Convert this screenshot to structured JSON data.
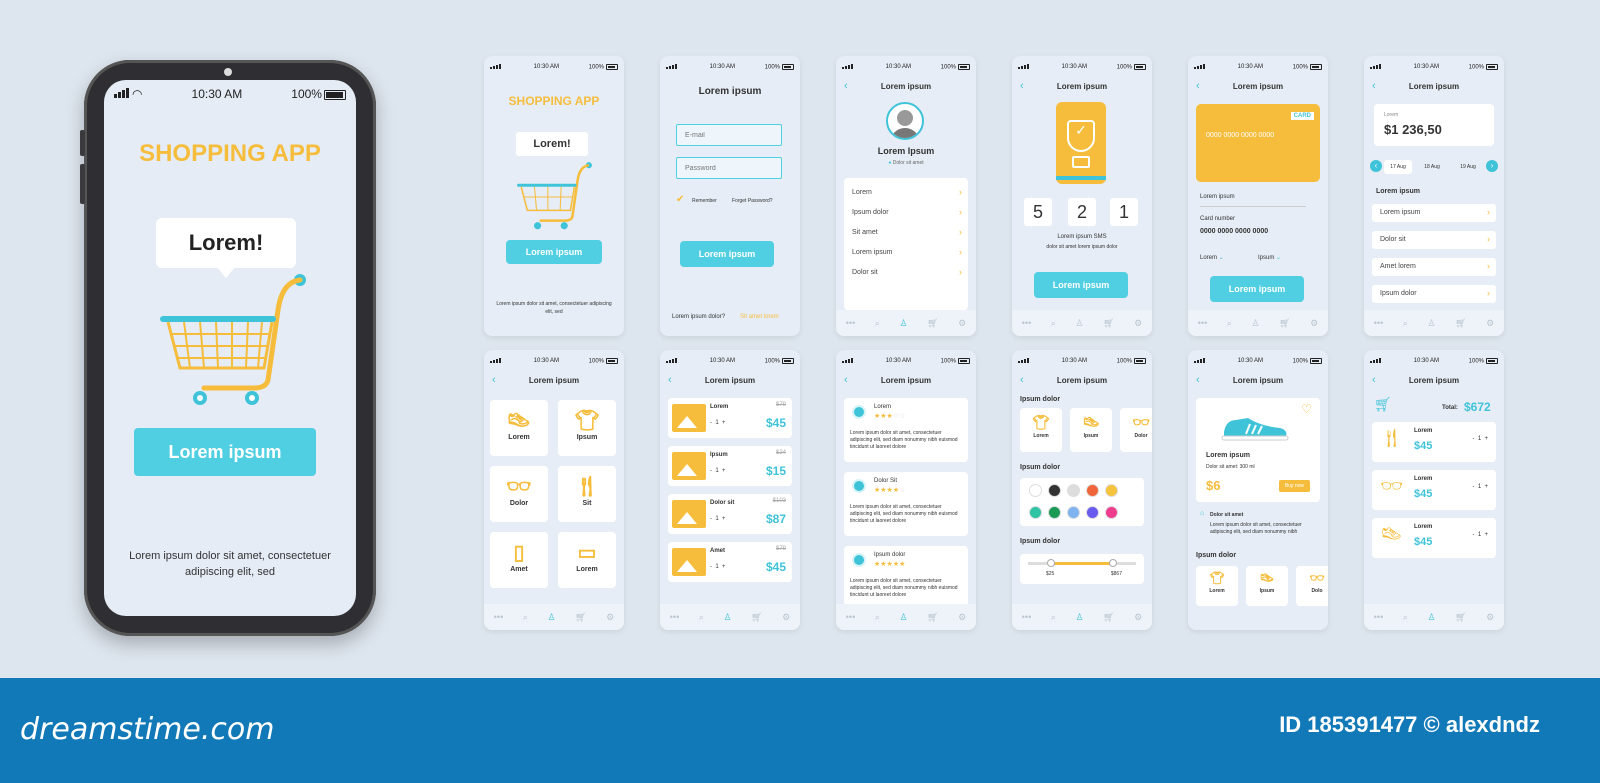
{
  "status": {
    "time": "10:30 AM",
    "battery": "100%"
  },
  "big": {
    "title": "SHOPPING APP",
    "bubble": "Lorem!",
    "button": "Lorem ipsum",
    "caption": "Lorem ipsum dolor sit amet, consectetuer adipiscing elit, sed"
  },
  "s1": {
    "title": "SHOPPING APP",
    "bubble": "Lorem!",
    "button": "Lorem ipsum",
    "caption": "Lorem ipsum dolor sit amet, consectetuer adipiscing elit, sed"
  },
  "s2": {
    "header": "Lorem ipsum",
    "email_placeholder": "E-mail",
    "password_placeholder": "Password",
    "remember": "Remember",
    "forgot": "Forget Password?",
    "button": "Lorem ipsum",
    "footer_q": "Lorem ipsum dolor?",
    "footer_link": "Sit amet lorem"
  },
  "s3": {
    "header": "Lorem ipsum",
    "name": "Lorem Ipsum",
    "location": "Dolor sit amet",
    "items": [
      "Lorem",
      "Ipsum dolor",
      "Sit amet",
      "Lorem ipsum",
      "Dolor sit"
    ]
  },
  "s4": {
    "header": "Lorem ipsum",
    "code": [
      "5",
      "2",
      "1"
    ],
    "sms": "Lorem ipsum SMS",
    "sms_sub": "dolor sit amet lorem ipsum dolor",
    "button": "Lorem ipsum"
  },
  "s5": {
    "header": "Lorem ipsum",
    "card_label": "CARD",
    "card_number": "0000 0000 0000 0000",
    "label1": "Lorem ipsum",
    "label2": "Card number",
    "number": "0000 0000 0000 0000",
    "dd1": "Lorem",
    "dd2": "Ipsum",
    "button": "Lorem ipsum"
  },
  "s6": {
    "header": "Lorem ipsum",
    "balance_label": "Lorem",
    "balance": "$1 236,50",
    "dates": [
      "17 Aug",
      "18 Aug",
      "19 Aug"
    ],
    "section": "Lorem ipsum",
    "items": [
      "Lorem ipsum",
      "Dolor sit",
      "Amet lorem",
      "Ipsum dolor"
    ]
  },
  "s7": {
    "header": "Lorem ipsum",
    "tiles": [
      "Lorem",
      "Ipsum",
      "Dolor",
      "Sit",
      "Amet",
      "Lorem"
    ]
  },
  "s8": {
    "header": "Lorem ipsum",
    "products": [
      {
        "name": "Lorem",
        "old": "$79",
        "price": "$45",
        "qty": "1"
      },
      {
        "name": "Ipsum",
        "old": "$24",
        "price": "$15",
        "qty": "1"
      },
      {
        "name": "Dolor sit",
        "old": "$103",
        "price": "$87",
        "qty": "1"
      },
      {
        "name": "Amet",
        "old": "$79",
        "price": "$45",
        "qty": "1"
      }
    ]
  },
  "s9": {
    "header": "Lorem ipsum",
    "reviews": [
      {
        "name": "Lorem",
        "stars": 3,
        "text": "Lorem ipsum dolor sit amet, consectetuer adipiscing elit, sed diam nonummy nibh euismod tincidunt ut laoreet dolore"
      },
      {
        "name": "Dolor Sit",
        "stars": 4,
        "text": "Lorem ipsum dolor sit amet, consectetuer adipiscing elit, sed diam nonummy nibh euismod tincidunt ut laoreet dolore"
      },
      {
        "name": "Ipsum dolor",
        "stars": 5,
        "text": "Lorem ipsum dolor sit amet, consectetuer adipiscing elit, sed diam nonummy nibh euismod tincidunt ut laoreet dolore"
      }
    ]
  },
  "s10": {
    "header": "Lorem ipsum",
    "sec1": "Ipsum dolor",
    "cats": [
      "Lorem",
      "Ipsum",
      "Dolor"
    ],
    "sec2": "Ipsum dolor",
    "colors": [
      "#ffffff",
      "#333333",
      "#dddddd",
      "#f0663a",
      "#f6c33c",
      "#2ec4a4",
      "#1a9a55",
      "#7fb3f0",
      "#6a5bf0",
      "#ef3b8c"
    ],
    "sec3": "Ipsum dolor",
    "min": "$25",
    "max": "$867"
  },
  "s11": {
    "header": "Lorem ipsum",
    "name": "Lorem ipsum",
    "desc": "Dolor sit amet: 300 ml",
    "price": "$6",
    "buy": "Buy now",
    "sub": "Dolor sit amet",
    "sub_text": "Lorem ipsum dolor sit amet, consectetuer adipiscing elit, sed diam nonummy nibh",
    "section": "Ipsum dolor",
    "cats": [
      "Lorem",
      "Ipsum",
      "Dolo"
    ]
  },
  "s12": {
    "header": "Lorem ipsum",
    "total_label": "Total:",
    "total": "$672",
    "items": [
      {
        "name": "Lorem",
        "price": "$45",
        "qty": "1"
      },
      {
        "name": "Lorem",
        "price": "$45",
        "qty": "1"
      },
      {
        "name": "Lorem",
        "price": "$45",
        "qty": "1"
      }
    ]
  },
  "footer": {
    "brand": "dreamstime.com",
    "id": "ID 185391477 © alexdndz"
  },
  "colors": {
    "accent": "#4fcfe1",
    "yellow": "#f6bd3c",
    "background": "#dde5ee",
    "footer": "#1279b8"
  }
}
